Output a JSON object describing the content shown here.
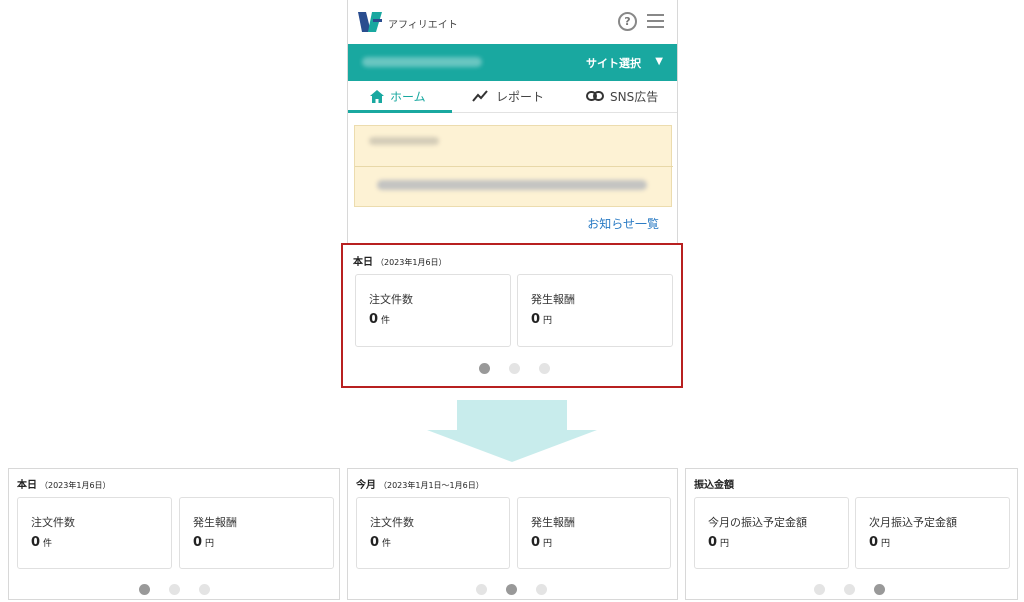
{
  "app": {
    "logo_text": "アフィリエイト"
  },
  "header": {
    "site_select_label": "サイト選択"
  },
  "tabs": [
    {
      "label": "ホーム",
      "icon": "home-icon",
      "active": true
    },
    {
      "label": "レポート",
      "icon": "chart-line-icon",
      "active": false
    },
    {
      "label": "SNS広告",
      "icon": "link-icon",
      "active": false
    }
  ],
  "news": {
    "link_label": "お知らせ一覧"
  },
  "panels": [
    {
      "title": "本日",
      "subtitle": "（2023年1月6日）",
      "stats": [
        {
          "label": "注文件数",
          "value": "0",
          "unit": "件"
        },
        {
          "label": "発生報酬",
          "value": "0",
          "unit": "円"
        }
      ],
      "active_dot": 0
    },
    {
      "title": "今月",
      "subtitle": "（2023年1月1日～1月6日）",
      "stats": [
        {
          "label": "注文件数",
          "value": "0",
          "unit": "件"
        },
        {
          "label": "発生報酬",
          "value": "0",
          "unit": "円"
        }
      ],
      "active_dot": 1
    },
    {
      "title": "振込金額",
      "subtitle": "",
      "stats": [
        {
          "label": "今月の振込予定金額",
          "value": "0",
          "unit": "円"
        },
        {
          "label": "次月振込予定金額",
          "value": "0",
          "unit": "円"
        }
      ],
      "active_dot": 2
    }
  ],
  "colors": {
    "accent": "#19a8a0",
    "highlight": "#b82020",
    "link": "#2a7bc4",
    "arrow": "#c8ecec"
  }
}
